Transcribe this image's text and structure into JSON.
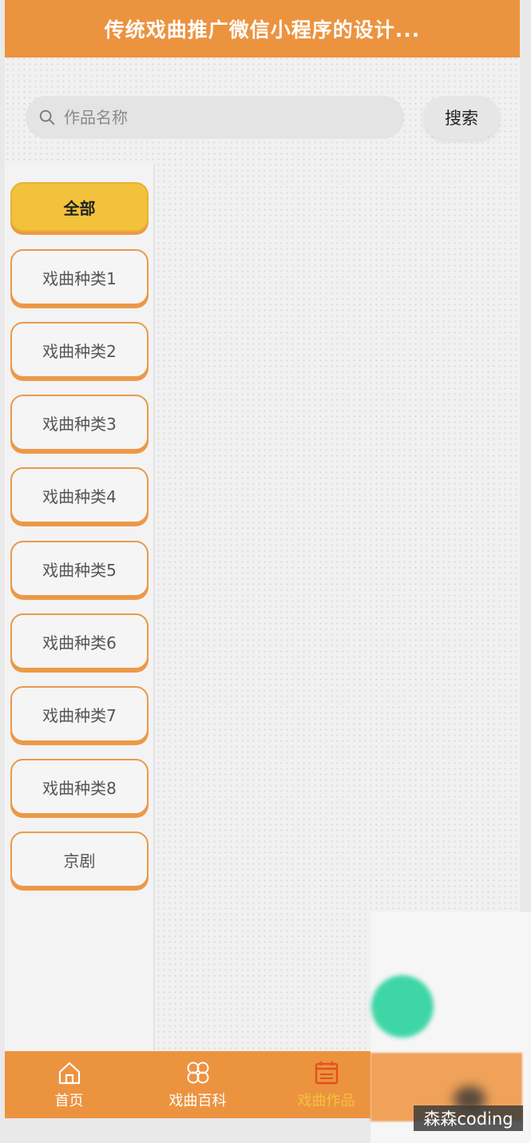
{
  "header": {
    "title": "传统戏曲推广微信小程序的设计..."
  },
  "search": {
    "placeholder": "作品名称",
    "value": "",
    "button_label": "搜索"
  },
  "categories": [
    {
      "label": "全部",
      "active": true
    },
    {
      "label": "戏曲种类1",
      "active": false
    },
    {
      "label": "戏曲种类2",
      "active": false
    },
    {
      "label": "戏曲种类3",
      "active": false
    },
    {
      "label": "戏曲种类4",
      "active": false
    },
    {
      "label": "戏曲种类5",
      "active": false
    },
    {
      "label": "戏曲种类6",
      "active": false
    },
    {
      "label": "戏曲种类7",
      "active": false
    },
    {
      "label": "戏曲种类8",
      "active": false
    },
    {
      "label": "京剧",
      "active": false
    }
  ],
  "tabbar": {
    "items": [
      {
        "label": "首页",
        "icon": "home-icon",
        "active": false
      },
      {
        "label": "戏曲百科",
        "icon": "encyclopedia-icon",
        "active": false
      },
      {
        "label": "戏曲作品",
        "icon": "works-icon",
        "active": true
      },
      {
        "label": "",
        "icon": "profile-icon",
        "active": false
      }
    ]
  },
  "watermark": {
    "text": "森森coding"
  },
  "colors": {
    "primary": "#ec9340",
    "active_category": "#f2c23c",
    "active_tab_text": "#f2c23c",
    "fab": "#3fd6a6"
  }
}
